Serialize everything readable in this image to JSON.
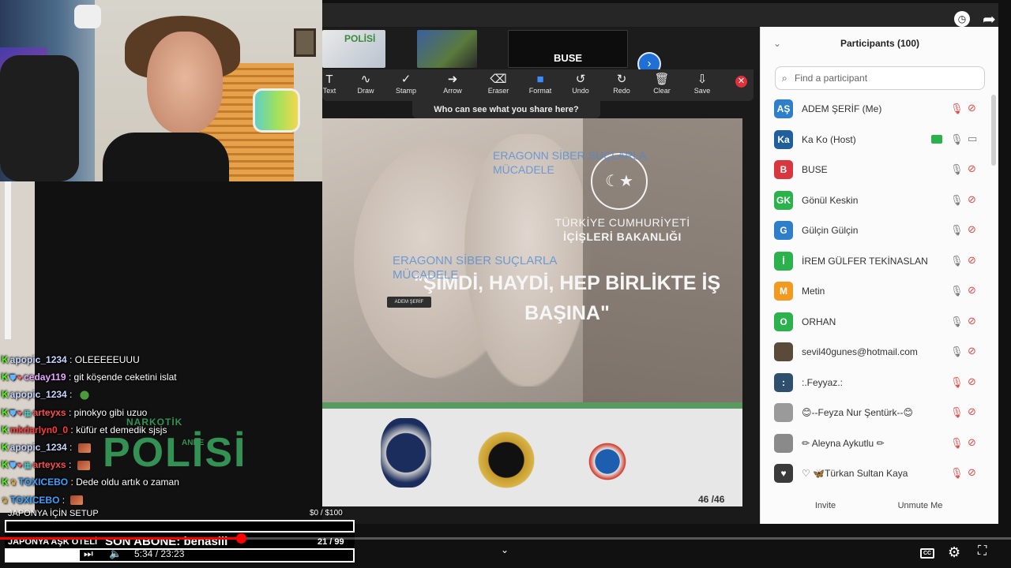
{
  "meeting": {
    "thumb_polisi": "POLİSİ",
    "thumb_active_name": "BUSE",
    "annotation_tools": [
      {
        "label": "Text",
        "icon": "text-icon",
        "glyph": "T"
      },
      {
        "label": "Draw",
        "icon": "draw-icon",
        "glyph": "∿"
      },
      {
        "label": "Stamp",
        "icon": "stamp-icon",
        "glyph": "✓"
      },
      {
        "label": "Arrow",
        "icon": "arrow-icon",
        "glyph": "➜"
      },
      {
        "label": "Eraser",
        "icon": "eraser-icon",
        "glyph": "⌫"
      },
      {
        "label": "Format",
        "icon": "format-icon",
        "glyph": "■"
      },
      {
        "label": "Undo",
        "icon": "undo-icon",
        "glyph": "↺"
      },
      {
        "label": "Redo",
        "icon": "redo-icon",
        "glyph": "↻"
      },
      {
        "label": "Clear",
        "icon": "trash-icon",
        "glyph": "🗑"
      },
      {
        "label": "Save",
        "icon": "save-icon",
        "glyph": "⇩"
      }
    ],
    "who_can_see": "Who can see what you share here?"
  },
  "slide": {
    "ministry_line1": "TÜRKİYE CUMHURİYETİ",
    "ministry_line2": "İÇİŞLERİ BAKANLIĞI",
    "quote": "\"ŞİMDİ, HAYDİ, HEP BİRLİKTE İŞ BAŞINA\"",
    "annotation_1": "ERAGONN SİBER SUÇLARLA MÜCADELE",
    "annotation_2": "ERAGONN SİBER SUÇLARLA MÜCADELE",
    "annotator_tag": "ADEM ŞERİF",
    "page": "46 /46",
    "logo_top": "NARKOTİK",
    "logo_main": "POLİSİ",
    "logo_sub": "ANNE"
  },
  "participants": {
    "title": "Participants (100)",
    "search_placeholder": "Find a participant",
    "list": [
      {
        "initials": "AŞ",
        "name": "ADEM ŞERİF (Me)",
        "color": "#2f7ec9",
        "mic_muted": true,
        "cam_on": false,
        "sharing": false
      },
      {
        "initials": "Ka",
        "name": "Ka Ko (Host)",
        "color": "#1f5f9e",
        "mic_muted": false,
        "cam_on": true,
        "sharing": true
      },
      {
        "initials": "B",
        "name": "BUSE",
        "color": "#d9363e",
        "mic_muted": false,
        "cam_on": false,
        "sharing": false
      },
      {
        "initials": "GK",
        "name": "Gönül Keskin",
        "color": "#2bb24c",
        "mic_muted": false,
        "cam_on": false,
        "sharing": false
      },
      {
        "initials": "G",
        "name": "Gülçin Gülçin",
        "color": "#2f7ec9",
        "mic_muted": false,
        "cam_on": false,
        "sharing": false
      },
      {
        "initials": "İ",
        "name": "İREM GÜLFER TEKİNASLAN",
        "color": "#2bb24c",
        "mic_muted": false,
        "cam_on": false,
        "sharing": false
      },
      {
        "initials": "M",
        "name": "Metin",
        "color": "#f29a1f",
        "mic_muted": false,
        "cam_on": false,
        "sharing": false
      },
      {
        "initials": "O",
        "name": "ORHAN",
        "color": "#2bb24c",
        "mic_muted": false,
        "cam_on": false,
        "sharing": false
      },
      {
        "initials": "",
        "name": "sevil40gunes@hotmail.com",
        "color": "#5a4a3a",
        "mic_muted": false,
        "cam_on": false,
        "sharing": false
      },
      {
        "initials": ":",
        "name": ":.Feyyaz.:",
        "color": "#2f4f6f",
        "mic_muted": true,
        "cam_on": false,
        "sharing": false
      },
      {
        "initials": "",
        "name": "😊--Feyza Nur Şentürk--😊",
        "color": "#9a9a9a",
        "mic_muted": true,
        "cam_on": false,
        "sharing": false
      },
      {
        "initials": "",
        "name": "✏ Aleyna Aykutlu ✏",
        "color": "#8a8a8a",
        "mic_muted": true,
        "cam_on": false,
        "sharing": false
      },
      {
        "initials": "♥",
        "name": "♡ 🦋Türkan Sultan Kaya",
        "color": "#3a3a3a",
        "mic_muted": true,
        "cam_on": false,
        "sharing": false
      }
    ],
    "invite_label": "Invite",
    "unmute_label": "Unmute Me"
  },
  "chat": [
    {
      "badges": [
        "k"
      ],
      "user": "apopic_1234",
      "user_color": "#c9d7ff",
      "message": "OLEEEEEUUU",
      "emote": ""
    },
    {
      "badges": [
        "k",
        "x",
        "h"
      ],
      "user": "ceday119",
      "user_color": "#e7a6ff",
      "message": "git köşende ceketini islat",
      "emote": ""
    },
    {
      "badges": [
        "k"
      ],
      "user": "apopic_1234",
      "user_color": "#c9d7ff",
      "message": "",
      "emote": "pepe"
    },
    {
      "badges": [
        "k",
        "x",
        "h",
        "g"
      ],
      "user": "arteyxs",
      "user_color": "#ff4d4d",
      "message": "pinokyo gibi uzuo",
      "emote": ""
    },
    {
      "badges": [
        "k"
      ],
      "user": "mkdarlyn0_0",
      "user_color": "#ff3b3b",
      "message": "küfür et demedik sjsjs",
      "emote": ""
    },
    {
      "badges": [
        "k"
      ],
      "user": "apopic_1234",
      "user_color": "#c9d7ff",
      "message": "",
      "emote": "pic"
    },
    {
      "badges": [
        "k",
        "x",
        "h",
        "g"
      ],
      "user": "arteyxs",
      "user_color": "#ff4d4d",
      "message": "",
      "emote": "pic"
    },
    {
      "badges": [
        "k",
        "c"
      ],
      "user": "TOXICEBO",
      "user_color": "#3aa0ff",
      "message": "Dede oldu artık o zaman",
      "emote": ""
    },
    {
      "badges": [
        "c"
      ],
      "user": "TOXICEBO",
      "user_color": "#3aa0ff",
      "message": "",
      "emote": "pic"
    }
  ],
  "goals": {
    "goal1_label": "JAPONYA İÇİN SETUP",
    "goal1_amount": "$0   / $100",
    "goal1_progress": 0,
    "goal2_label": "JAPONYA AŞK OTELİ",
    "goal2_sub": "SON ABONE: benaslii",
    "goal2_count": "21   / 99",
    "goal2_progress": 0.212
  },
  "player": {
    "time": "5:34 / 23:23",
    "progress": 0.238,
    "cc_label": "CC"
  }
}
